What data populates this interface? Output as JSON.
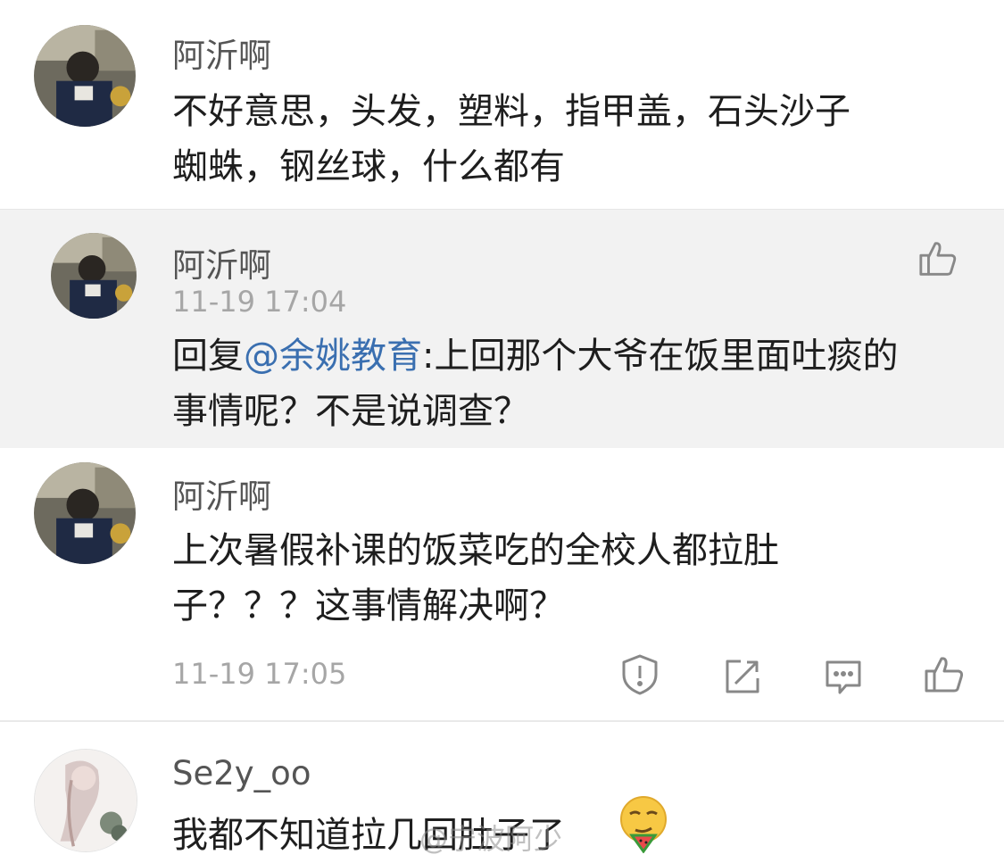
{
  "comments": [
    {
      "username": "阿沂啊",
      "lines": [
        "不好意思，头发，塑料，指甲盖，石头沙子",
        "蜘蛛，钢丝球，什么都有"
      ]
    },
    {
      "username": "阿沂啊",
      "time": "11-19 17:04",
      "reply_prefix": "回复",
      "mention": "@余姚教育",
      "line1_rest": ":上回那个大爷在饭里面吐痰的",
      "line2": "事情呢？不是说调查？"
    },
    {
      "username": "阿沂啊",
      "lines": [
        "上次暑假补课的饭菜吃的全校人都拉肚",
        "子？？？这事情解决啊？"
      ],
      "time": "11-19 17:05",
      "actions": [
        "report-icon",
        "repost-icon",
        "comment-icon",
        "like-icon"
      ]
    },
    {
      "username": "Se2y_oo",
      "text": "我都不知道拉几回肚子了",
      "emoji": "smirk-face-eating-watermelon"
    }
  ],
  "watermark": "@宁波阿少",
  "colors": {
    "username": "#555555",
    "text": "#1e1e1e",
    "mention": "#3a6fb0",
    "time": "#a6a6a6",
    "icon": "#888888",
    "highlight_bg": "#f2f2f2"
  }
}
